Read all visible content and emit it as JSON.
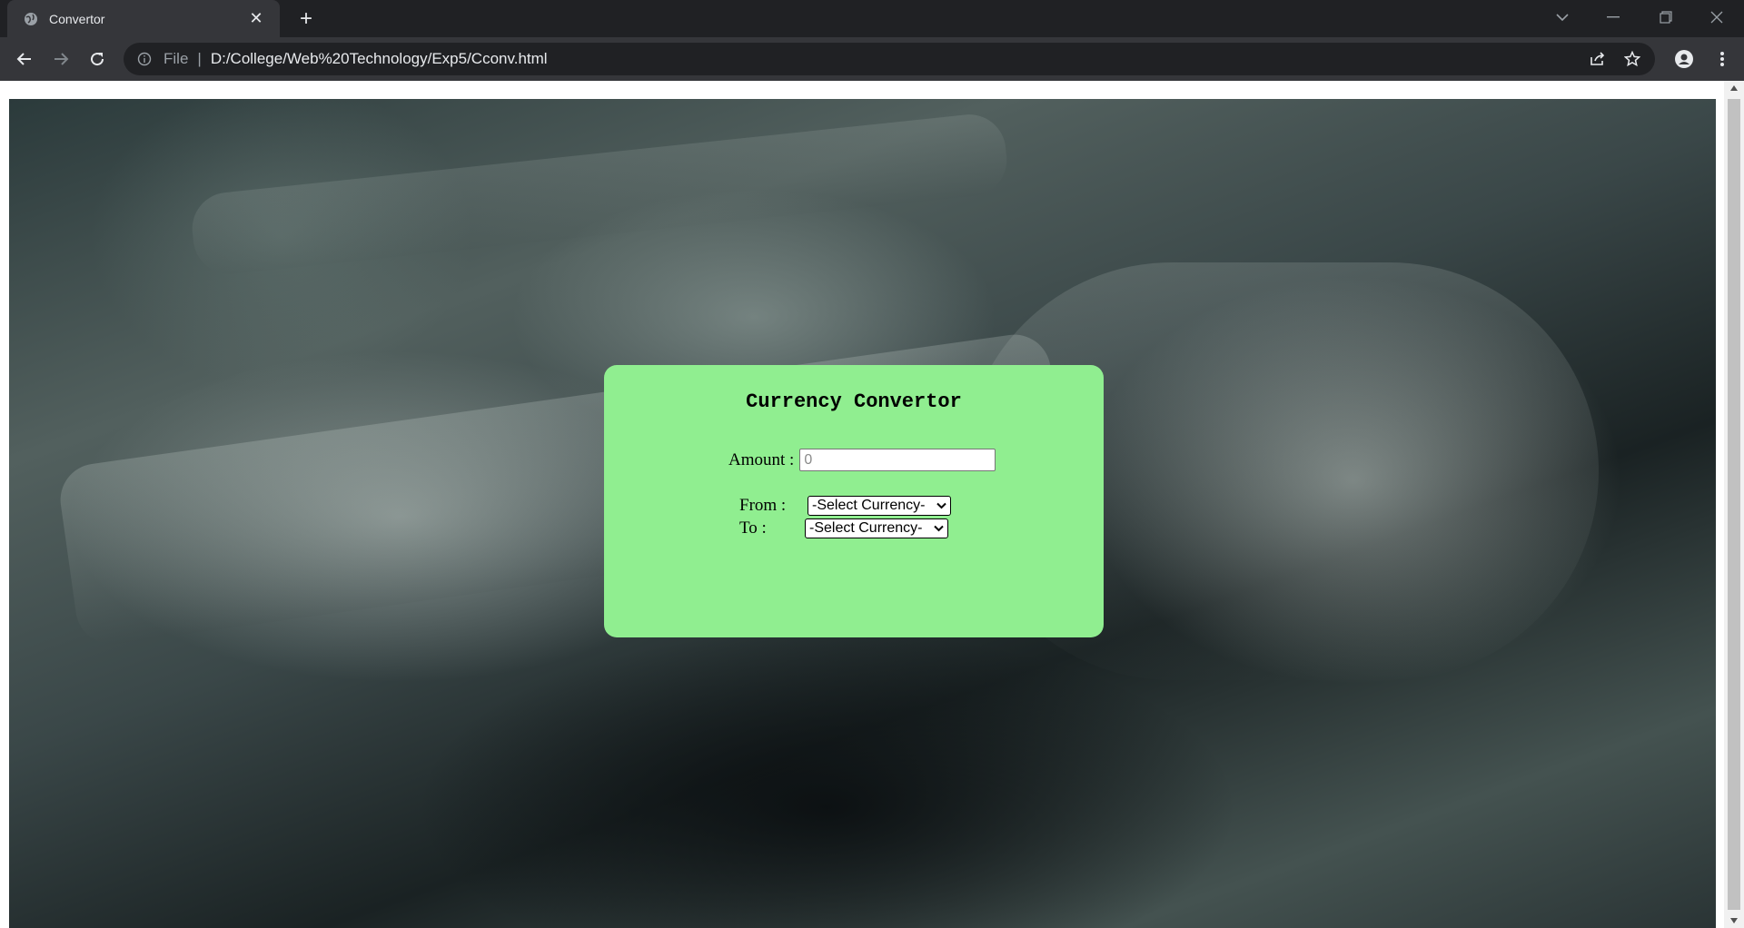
{
  "browser": {
    "tab": {
      "title": "Convertor"
    },
    "address": {
      "scheme_label": "File",
      "url": "D:/College/Web%20Technology/Exp5/Cconv.html"
    }
  },
  "converter": {
    "heading": "Currency Convertor",
    "amount_label": "Amount :",
    "amount_placeholder": "0",
    "from_label": "From :",
    "to_label": "To :",
    "from_selected": "-Select Currency-",
    "to_selected": "-Select Currency-"
  }
}
